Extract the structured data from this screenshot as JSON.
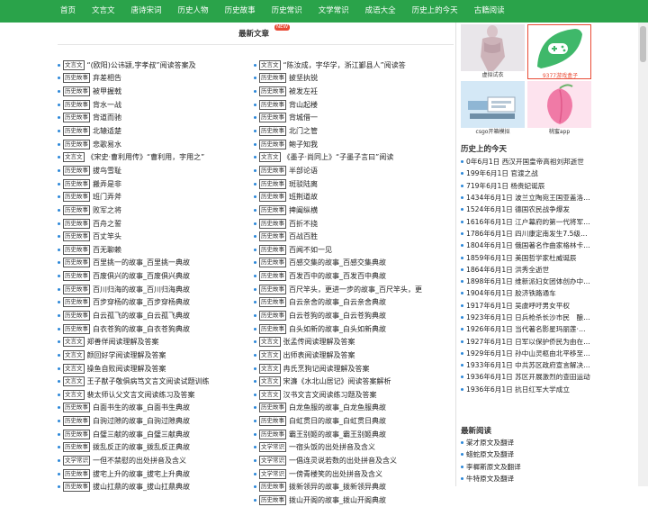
{
  "nav": {
    "items": [
      "首页",
      "文言文",
      "唐诗宋词",
      "历史人物",
      "历史故事",
      "历史常识",
      "文学常识",
      "成语大全",
      "历史上的今天",
      "古籍阅读"
    ],
    "bg": "#2aa34a"
  },
  "main": {
    "title": "最新文章",
    "badge": "NEW",
    "left": [
      {
        "tag": "文言文",
        "title": "“(欧阳)公讳颍,字孝叔”阅读答案及"
      },
      {
        "tag": "历史故事",
        "title": "弃差相告"
      },
      {
        "tag": "历史故事",
        "title": "被甲握戟"
      },
      {
        "tag": "历史故事",
        "title": "背水一战"
      },
      {
        "tag": "历史故事",
        "title": "背道而驰"
      },
      {
        "tag": "历史故事",
        "title": "北辕适楚"
      },
      {
        "tag": "历史故事",
        "title": "悲歌易水"
      },
      {
        "tag": "文言文",
        "title": "《宋史·曹利用传》“曹利用，字用之”"
      },
      {
        "tag": "历史故事",
        "title": "拔鸟雪耻"
      },
      {
        "tag": "历史故事",
        "title": "搬弄是非"
      },
      {
        "tag": "历史故事",
        "title": "班门弄斧"
      },
      {
        "tag": "历史故事",
        "title": "败军之将"
      },
      {
        "tag": "历史故事",
        "title": "百舟之誓"
      },
      {
        "tag": "历史故事",
        "title": "百丈竿头"
      },
      {
        "tag": "历史故事",
        "title": "百无聊赖"
      },
      {
        "tag": "历史故事",
        "title": "百里挑一的故事_百里挑一典故"
      },
      {
        "tag": "历史故事",
        "title": "百废俱兴的故事_百废俱兴典故"
      },
      {
        "tag": "历史故事",
        "title": "百川归海的故事_百川归海典故"
      },
      {
        "tag": "历史故事",
        "title": "百步穿杨的故事_百步穿杨典故"
      },
      {
        "tag": "历史故事",
        "title": "白云孤飞的故事_白云孤飞典故"
      },
      {
        "tag": "历史故事",
        "title": "白衣苍狗的故事_白衣苍狗典故"
      },
      {
        "tag": "文言文",
        "title": "郑善佯阅读理解及答案"
      },
      {
        "tag": "文言文",
        "title": "颜回好学阅读理解及答案"
      },
      {
        "tag": "文言文",
        "title": "操鱼自败阅读理解及答案"
      },
      {
        "tag": "文言文",
        "title": "王子猷子敬俱病笃文言文阅读试题训练"
      },
      {
        "tag": "文言文",
        "title": "裴太师认父文言文阅读练习及答案"
      },
      {
        "tag": "历史故事",
        "title": "白面书生的故事_白面书生典故"
      },
      {
        "tag": "历史故事",
        "title": "白驹过隙的故事_白驹过隙典故"
      },
      {
        "tag": "历史故事",
        "title": "白璧三献的故事_白璧三献典故"
      },
      {
        "tag": "历史故事",
        "title": "拨乱反正的故事_拨乱反正典故"
      },
      {
        "tag": "文学常识",
        "title": "一但不禁慰的出处拼音及含义"
      },
      {
        "tag": "历史故事",
        "title": "拔宅上升的故事_拔宅上升典故"
      },
      {
        "tag": "历史故事",
        "title": "拔山扛鼎的故事_拔山扛鼎典故"
      }
    ],
    "right": [
      {
        "tag": "文言文",
        "title": "“陈汝成，字华学，浙江鄞县人”阅读答"
      },
      {
        "tag": "历史故事",
        "title": "披坚执锐"
      },
      {
        "tag": "历史故事",
        "title": "被发左衽"
      },
      {
        "tag": "历史故事",
        "title": "背山起楼"
      },
      {
        "tag": "历史故事",
        "title": "背城借一"
      },
      {
        "tag": "历史故事",
        "title": "北门之管"
      },
      {
        "tag": "历史故事",
        "title": "鲍子知我"
      },
      {
        "tag": "文言文",
        "title": "《墨子·尚同上》“子墨子言曰”阅读"
      },
      {
        "tag": "历史故事",
        "title": "半部论语"
      },
      {
        "tag": "历史故事",
        "title": "斑驳陆离"
      },
      {
        "tag": "历史故事",
        "title": "班荆道故"
      },
      {
        "tag": "历史故事",
        "title": "捭阖纵横"
      },
      {
        "tag": "历史故事",
        "title": "百折不挠"
      },
      {
        "tag": "历史故事",
        "title": "百战百胜"
      },
      {
        "tag": "历史故事",
        "title": "百闻不如一见"
      },
      {
        "tag": "历史故事",
        "title": "百感交集的故事_百感交集典故"
      },
      {
        "tag": "历史故事",
        "title": "百发百中的故事_百发百中典故"
      },
      {
        "tag": "历史故事",
        "title": "百尺竿头，更进一步的故事_百尺竿头，更"
      },
      {
        "tag": "历史故事",
        "title": "白云亲舍的故事_白云亲舍典故"
      },
      {
        "tag": "历史故事",
        "title": "白云苍狗的故事_白云苍狗典故"
      },
      {
        "tag": "历史故事",
        "title": "白头如新的故事_白头如新典故"
      },
      {
        "tag": "文言文",
        "title": "张孟传阅读理解及答案"
      },
      {
        "tag": "文言文",
        "title": "出师表阅读理解及答案"
      },
      {
        "tag": "文言文",
        "title": "冉氏烹狗记阅读理解及答案"
      },
      {
        "tag": "文言文",
        "title": "宋濂《水北山居记》阅读答案解析"
      },
      {
        "tag": "文言文",
        "title": "汉书文言文阅读练习题及答案"
      },
      {
        "tag": "历史故事",
        "title": "白龙鱼服的故事_白龙鱼服典故"
      },
      {
        "tag": "历史故事",
        "title": "白虹贯日的故事_白虹贯日典故"
      },
      {
        "tag": "历史故事",
        "title": "霸王别姬的故事_霸王别姬典故"
      },
      {
        "tag": "文学常识",
        "title": "一宿头饭的出处拼音及含义"
      },
      {
        "tag": "文学常识",
        "title": "一倡连灵说若数的出处拼音及含义"
      },
      {
        "tag": "文学常识",
        "title": "一傍青楼笑的出处拼音及含义"
      },
      {
        "tag": "历史故事",
        "title": "拨新领异的故事_拨新领异典故"
      },
      {
        "tag": "历史故事",
        "title": "拨山开阁的故事_拨山开阁典故"
      }
    ]
  },
  "sidebar": {
    "thumbs": [
      {
        "caption": "虚拟试衣"
      },
      {
        "caption": "9377游戏盒子"
      },
      {
        "caption": "csgo开箱模拟"
      },
      {
        "caption": "桃蜜app"
      }
    ],
    "history_title": "历史上的今天",
    "history": [
      "0年6月1日 西汉开国皇帝高祖刘邦逝世",
      "199年6月1日 官渡之战",
      "719年6月1日 杨贵妃诞辰",
      "1434年6月1日 波兰立陶宛王国亚盖洛…",
      "1524年6月1日 德国农民战争爆发",
      "1616年6月1日 江户幕府的第一代将军…",
      "1786年6月1日 四川康定南发生7.5级…",
      "1804年6月1日 俄国著名作曲家格林卡…",
      "1859年6月1日 美国哲学家杜威诞辰",
      "1864年6月1日 洪秀全逝世",
      "1898年6月1日 维新派妇女团体创办中…",
      "1904年6月1日 胶济铁路通车",
      "1917年6月1日 吴虞呼吁男女平权",
      "1923年6月1日 日兵枪杀长沙市民　酿…",
      "1926年6月1日 当代著名影星玛丽莲·…",
      "1927年6月1日 日军以保护侨民为由在…",
      "1929年6月1日 孙中山灵柩由北平移至…",
      "1933年6月1日 中共苏区政府宣言解决…",
      "1936年6月1日 苏区开展激烈的查田运动",
      "1936年6月1日 抗日红军大学成立"
    ],
    "latest_title": "最新阅读",
    "latest": [
      "棠才原文及翻译",
      "蜡蛇原文及翻译",
      "李樨斯原文及翻译",
      "牛特原文及翻译"
    ]
  }
}
